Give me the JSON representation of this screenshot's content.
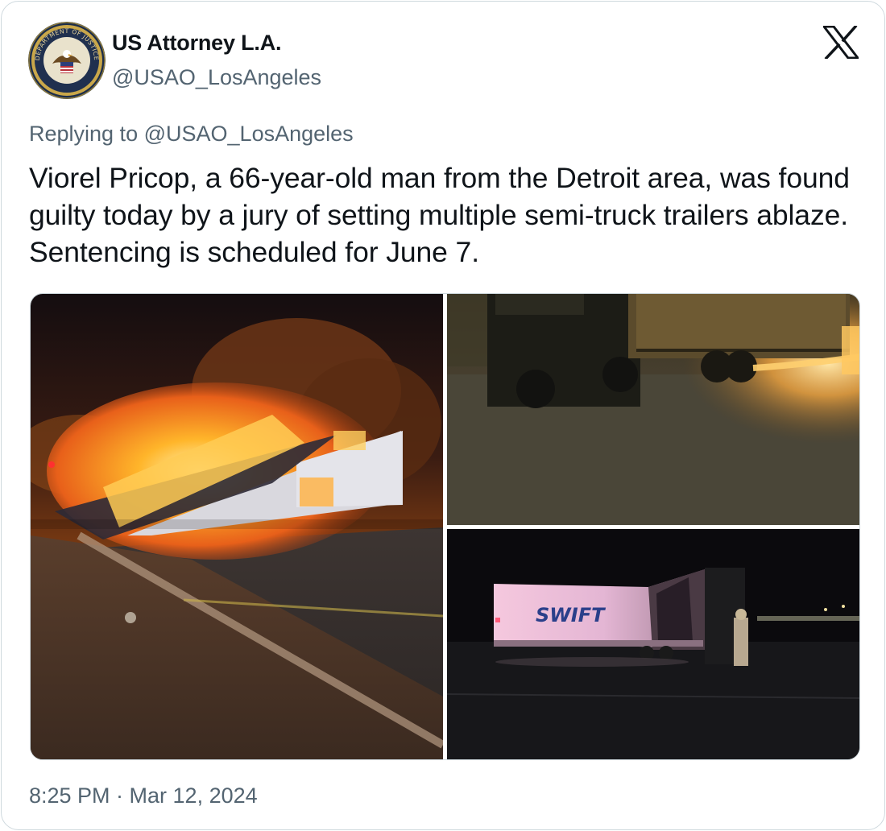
{
  "app": {
    "name": "X"
  },
  "author": {
    "display_name": "US Attorney L.A.",
    "handle": "@USAO_LosAngeles",
    "avatar_icon": "department-of-justice-seal-icon",
    "avatar_text": "DEPARTMENT OF JUSTICE"
  },
  "brand_icon": "x-logo-icon",
  "reply": {
    "prefix": "Replying to",
    "handle": "@USAO_LosAngeles"
  },
  "tweet": {
    "text": "Viorel Pricop, a 66-year-old man from the Detroit area, was found guilty today by a jury of setting multiple semi-truck trailers ablaze. Sentencing is scheduled for June 7."
  },
  "media": {
    "photos": [
      {
        "subject": "trailer-on-fire-night"
      },
      {
        "subject": "semi-truck-with-fire-under-trailer"
      },
      {
        "subject": "burned-trailer-with-firefighter",
        "trailer_text": "SWIFT"
      }
    ]
  },
  "timestamp": "8:25 PM · Mar 12, 2024",
  "colors": {
    "text_primary": "#0f1419",
    "text_secondary": "#536471",
    "border": "#cfd9de"
  }
}
